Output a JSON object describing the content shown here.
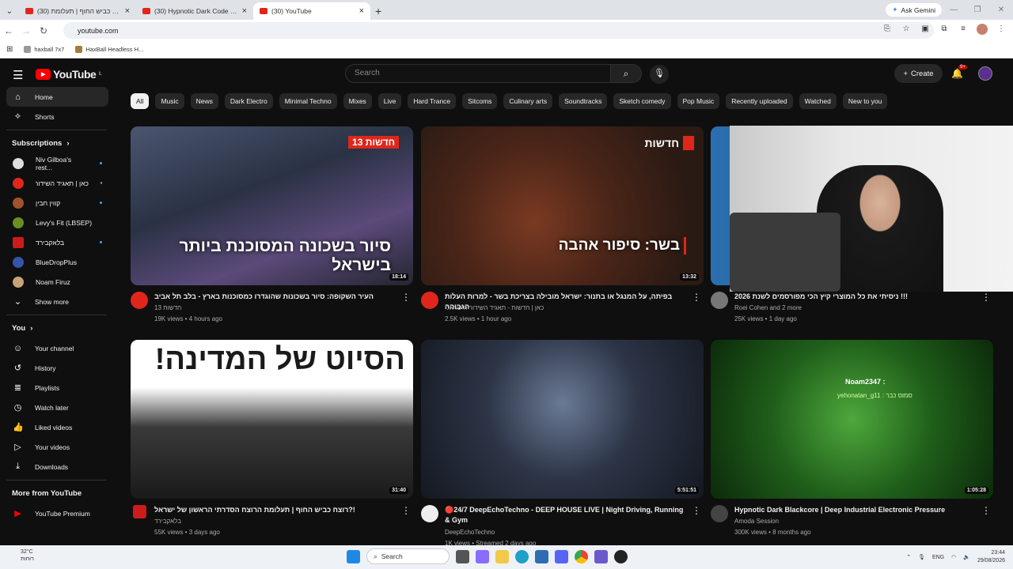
{
  "browser": {
    "tabs": [
      {
        "title": "(30) רוצח כביש החוף | תעלומת"
      },
      {
        "title": "(30) Hypnotic Dark Code | Futur"
      },
      {
        "title": "(30) YouTube"
      }
    ],
    "gemini": "Ask Gemini",
    "url": "youtube.com",
    "bookmarks": [
      "haxball 7x7",
      "HaxBall Headless H..."
    ]
  },
  "youtube": {
    "logo": "YouTube",
    "country": "IL",
    "search_placeholder": "Search",
    "create": "Create",
    "notif_badge": "9+",
    "sidebar": {
      "main": [
        {
          "label": "Home",
          "icon": "home-icon"
        },
        {
          "label": "Shorts",
          "icon": "shorts-icon"
        }
      ],
      "subs_title": "Subscriptions",
      "subs": [
        {
          "label": "Niv Gilboa's rest...",
          "color": "#ddd"
        },
        {
          "label": "כאן | תאגיד השידור הישראלי",
          "color": "#e0261b"
        },
        {
          "label": "קווין חבין",
          "color": "#a0522d"
        },
        {
          "label": "Levy's Fit (LBSEP)",
          "color": "#6b8e23"
        },
        {
          "label": "בלאקבירד",
          "color": "#cc1b1b"
        },
        {
          "label": "BlueDropPlus",
          "color": "#3355aa"
        },
        {
          "label": "Noam Firuz",
          "color": "#c8a27a"
        }
      ],
      "show_more": "Show more",
      "you_title": "You",
      "you": [
        {
          "label": "Your channel",
          "icon": "channel-icon"
        },
        {
          "label": "History",
          "icon": "history-icon"
        },
        {
          "label": "Playlists",
          "icon": "playlists-icon"
        },
        {
          "label": "Watch later",
          "icon": "watch-later-icon"
        },
        {
          "label": "Liked videos",
          "icon": "like-icon"
        },
        {
          "label": "Your videos",
          "icon": "your-videos-icon"
        },
        {
          "label": "Downloads",
          "icon": "download-icon"
        }
      ],
      "more_title": "More from YouTube",
      "premium": "YouTube Premium"
    },
    "chips": [
      "All",
      "Music",
      "News",
      "Dark Electro",
      "Minimal Techno",
      "Mixes",
      "Live",
      "Hard Trance",
      "Sitcoms",
      "Culinary arts",
      "Soundtracks",
      "Sketch comedy",
      "Pop Music",
      "Recently uploaded",
      "Watched",
      "New to you"
    ],
    "videos": [
      {
        "title": "העיר השקופה: סיור בשכונות שהוגדרו כמסוכנות בארץ - בלב תל אביב",
        "channel": "חדשות 13",
        "stats": "19K views • 4 hours ago",
        "duration": "18:14",
        "overlay": "סיור בשכונה המסוכנת ביותר בישראל",
        "badge": "חדשות 13",
        "av": "#e0261b"
      },
      {
        "title": "בפיתה, על המנגל או בתנור: ישראל מובילה בצריכת בשר - למרות העלות הגבוהה",
        "channel": "כאן | חדשות - תאגיד השידור הישראלי",
        "stats": "2.5K views • 1 hour ago",
        "duration": "13:32",
        "overlay": "בשר: סיפור אהבה",
        "badge": "חדשות",
        "av": "#e0261b"
      },
      {
        "title": "ניסיתי את כל המוצרי קיץ הכי מפורסמים לשנת 2026 !!!",
        "channel": "Roei Cohen and 2 more",
        "stats": "25K views • 1 day ago",
        "duration": "",
        "overlay": "",
        "badge": "",
        "av": "#777"
      },
      {
        "title": "רוצח כביש החוף | תעלומת הרוצח הסדרתי הראשון של ישראל?!",
        "channel": "בלאקבירד",
        "stats": "55K views • 3 days ago",
        "duration": "31:40",
        "overlay": "הסיוט של המדינה!",
        "badge": "",
        "av": "#cc1b1b"
      },
      {
        "title": "🔴24/7 DeepEchoTechno - DEEP HOUSE LIVE | Night Driving, Running & Gym",
        "channel": "DeepEchoTechno",
        "stats": "1K views • Streamed 2 days ago",
        "duration": "5:51:51",
        "overlay": "",
        "badge": "",
        "av": "#eee"
      },
      {
        "title": "Hypnotic Dark Blackcore | Deep Industrial Electronic Pressure",
        "channel": "Amoda Session",
        "stats": "300K views • 8 months ago",
        "duration": "1:05:28",
        "overlay": "",
        "badge": "",
        "av": "#444"
      }
    ],
    "stream_chat": [
      "Noam2347 :",
      "yehonatan_g11 : סמוס כבר"
    ]
  },
  "taskbar": {
    "weather_temp": "32°C",
    "weather_desc": "רוחות",
    "search": "Search",
    "lang": "ENG",
    "time": "23:44",
    "date": "29/08/2026"
  }
}
